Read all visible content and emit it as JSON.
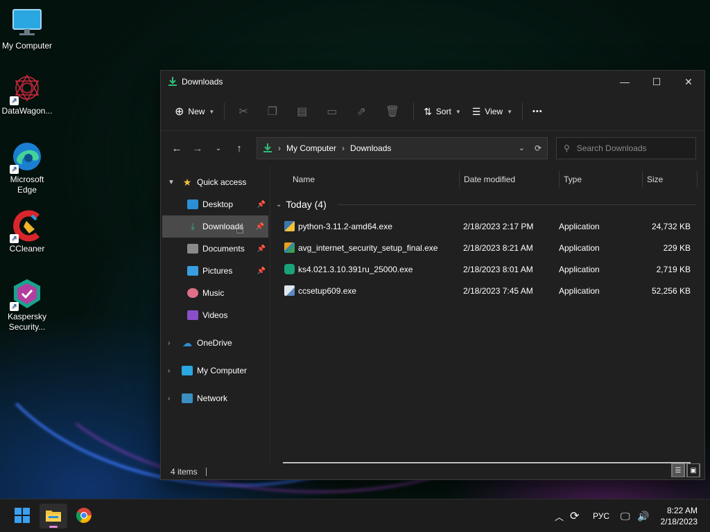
{
  "desktop": {
    "icons": [
      {
        "label": "My Computer"
      },
      {
        "label": "DataWagon..."
      },
      {
        "label": "Microsoft Edge"
      },
      {
        "label": "CCleaner"
      },
      {
        "label": "Kaspersky Security..."
      }
    ]
  },
  "window": {
    "title": "Downloads",
    "toolbar": {
      "new_label": "New",
      "sort_label": "Sort",
      "view_label": "View",
      "more_label": "•••"
    },
    "address": {
      "segments": [
        "My Computer",
        "Downloads"
      ]
    },
    "search": {
      "placeholder": "Search Downloads"
    },
    "sidebar": {
      "quick_access": "Quick access",
      "items": [
        {
          "label": "Desktop",
          "pinned": true
        },
        {
          "label": "Downloads",
          "pinned": true,
          "selected": true
        },
        {
          "label": "Documents",
          "pinned": true
        },
        {
          "label": "Pictures",
          "pinned": true
        },
        {
          "label": "Music",
          "pinned": false
        },
        {
          "label": "Videos",
          "pinned": false
        }
      ],
      "roots": [
        {
          "label": "OneDrive"
        },
        {
          "label": "My Computer"
        },
        {
          "label": "Network"
        }
      ]
    },
    "columns": {
      "name": "Name",
      "date": "Date modified",
      "type": "Type",
      "size": "Size"
    },
    "group": {
      "label": "Today (4)"
    },
    "files": [
      {
        "name": "python-3.11.2-amd64.exe",
        "date": "2/18/2023 2:17 PM",
        "type": "Application",
        "size": "24,732 KB",
        "icon": "python-installer-icon"
      },
      {
        "name": "avg_internet_security_setup_final.exe",
        "date": "2/18/2023 8:21 AM",
        "type": "Application",
        "size": "229 KB",
        "icon": "avg-installer-icon"
      },
      {
        "name": "ks4.021.3.10.391ru_25000.exe",
        "date": "2/18/2023 8:01 AM",
        "type": "Application",
        "size": "2,719 KB",
        "icon": "kaspersky-installer-icon"
      },
      {
        "name": "ccsetup609.exe",
        "date": "2/18/2023 7:45 AM",
        "type": "Application",
        "size": "52,256 KB",
        "icon": "ccleaner-installer-icon"
      }
    ],
    "status": {
      "items_count": "4 items"
    }
  },
  "taskbar": {
    "language": "РУС",
    "time": "8:22 AM",
    "date": "2/18/2023"
  },
  "colors": {
    "window_bg": "#202020",
    "accent_download": "#2bbf7a",
    "folder_yellow": "#f3c13a",
    "selected_bg": "#4a4a4a"
  }
}
